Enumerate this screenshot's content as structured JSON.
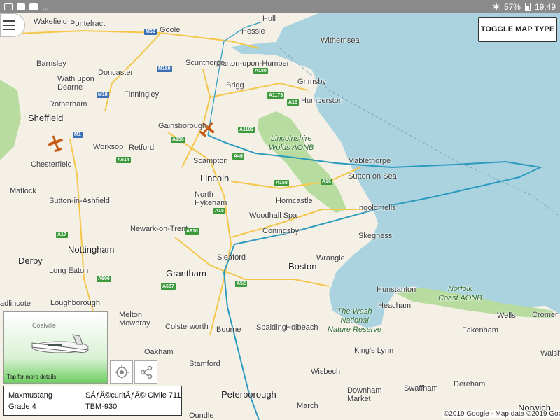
{
  "status_bar": {
    "battery": "57%",
    "time": "19:49",
    "overflow": "..."
  },
  "map": {
    "places": [
      {
        "id": "wakefield",
        "label": "Wakefield"
      },
      {
        "id": "pontefract",
        "label": "Pontefract"
      },
      {
        "id": "goole",
        "label": "Goole"
      },
      {
        "id": "hull",
        "label": "Hull"
      },
      {
        "id": "hessle",
        "label": "Hessle"
      },
      {
        "id": "withernsea",
        "label": "Withernsea"
      },
      {
        "id": "barton",
        "label": "Barton-upon-Humber"
      },
      {
        "id": "barnsley",
        "label": "Barnsley"
      },
      {
        "id": "scunthorpe",
        "label": "Scunthorpe"
      },
      {
        "id": "doncaster",
        "label": "Doncaster"
      },
      {
        "id": "wath",
        "label": "Wath upon\nDearne"
      },
      {
        "id": "grimsby",
        "label": "Grimsby"
      },
      {
        "id": "brigg",
        "label": "Brigg"
      },
      {
        "id": "finningley",
        "label": "Finningley"
      },
      {
        "id": "rotherham",
        "label": "Rotherham"
      },
      {
        "id": "humberston",
        "label": "Humberston"
      },
      {
        "id": "sheffield",
        "label": "Sheffield"
      },
      {
        "id": "gainsborough",
        "label": "Gainsborough"
      },
      {
        "id": "worksop",
        "label": "Worksop"
      },
      {
        "id": "retford",
        "label": "Retford"
      },
      {
        "id": "mablethorpe",
        "label": "Mablethorpe"
      },
      {
        "id": "chesterfield",
        "label": "Chesterfield"
      },
      {
        "id": "scampton",
        "label": "Scampton"
      },
      {
        "id": "lincoln",
        "label": "Lincoln"
      },
      {
        "id": "sutton-on-sea",
        "label": "Sutton on Sea"
      },
      {
        "id": "matlock",
        "label": "Matlock"
      },
      {
        "id": "north-hykeham",
        "label": "North\nHykeham"
      },
      {
        "id": "horncastle",
        "label": "Horncastle"
      },
      {
        "id": "sutton-in-ashfield",
        "label": "Sutton-in-Ashfield"
      },
      {
        "id": "ingoldmells",
        "label": "Ingoldmells"
      },
      {
        "id": "woodhall-spa",
        "label": "Woodhall Spa"
      },
      {
        "id": "newark",
        "label": "Newark-on-Trent"
      },
      {
        "id": "coningsby",
        "label": "Coningsby"
      },
      {
        "id": "skegness",
        "label": "Skegness"
      },
      {
        "id": "nottingham",
        "label": "Nottingham"
      },
      {
        "id": "derby",
        "label": "Derby"
      },
      {
        "id": "sleaford",
        "label": "Sleaford"
      },
      {
        "id": "wrangle",
        "label": "Wrangle"
      },
      {
        "id": "long-eaton",
        "label": "Long Eaton"
      },
      {
        "id": "grantham",
        "label": "Grantham"
      },
      {
        "id": "boston",
        "label": "Boston"
      },
      {
        "id": "hunstanton",
        "label": "Hunstanton"
      },
      {
        "id": "loughborough",
        "label": "Loughborough"
      },
      {
        "id": "heacham",
        "label": "Heacham"
      },
      {
        "id": "wells",
        "label": "Wells"
      },
      {
        "id": "cromer",
        "label": "Cromer"
      },
      {
        "id": "melton",
        "label": "Melton\nMowbray"
      },
      {
        "id": "colsterworth",
        "label": "Colsterworth"
      },
      {
        "id": "bourne",
        "label": "Bourne"
      },
      {
        "id": "spalding",
        "label": "Spalding"
      },
      {
        "id": "holbeach",
        "label": "Holbeach"
      },
      {
        "id": "fakenham",
        "label": "Fakenham"
      },
      {
        "id": "coalville",
        "label": "Coalville"
      },
      {
        "id": "kings-lynn",
        "label": "King's Lynn"
      },
      {
        "id": "oakham",
        "label": "Oakham"
      },
      {
        "id": "stamford",
        "label": "Stamford"
      },
      {
        "id": "wisbech",
        "label": "Wisbech"
      },
      {
        "id": "swaffham",
        "label": "Swaffham"
      },
      {
        "id": "dereham",
        "label": "Dereham"
      },
      {
        "id": "walsh",
        "label": "Walsh"
      },
      {
        "id": "downham-market",
        "label": "Downham\nMarket"
      },
      {
        "id": "peterborough",
        "label": "Peterborough"
      },
      {
        "id": "march",
        "label": "March"
      },
      {
        "id": "norwich",
        "label": "Norwich"
      },
      {
        "id": "oundle",
        "label": "Oundle"
      },
      {
        "id": "adlincote",
        "label": "adlincote"
      }
    ],
    "aonb_labels": [
      {
        "id": "lincs-wolds",
        "label": "Lincolnshire\nWolds AONB"
      },
      {
        "id": "norfolk-coast",
        "label": "Norfolk\nCoast AONB"
      },
      {
        "id": "the-wash",
        "label": "The Wash\nNational\nNature Reserve"
      }
    ],
    "roads": [
      "M62",
      "A180",
      "M180",
      "M18",
      "A1173",
      "A18",
      "M1",
      "A1103",
      "A156",
      "A46",
      "A614",
      "A158",
      "A16",
      "A15",
      "A610",
      "A17",
      "A606",
      "A52",
      "A607"
    ]
  },
  "controls": {
    "toggle_map_type": "TOGGLE MAP TYPE"
  },
  "aircraft_card": {
    "hint": "Tap for more details"
  },
  "info_panel": {
    "callsign": "Maxmustang",
    "operator": "SÃƒÂ©curitÃƒÂ© Civile 711",
    "category": "Grade 4",
    "model": "TBM-930"
  },
  "attribution": "©2019 Google - Map data ©2019 Google",
  "colors": {
    "sea": "#aad3df",
    "land": "#f5f0e6",
    "aonb": "#b8dca0",
    "track": "#2a9bbf",
    "aircraft": "#c65a12"
  }
}
